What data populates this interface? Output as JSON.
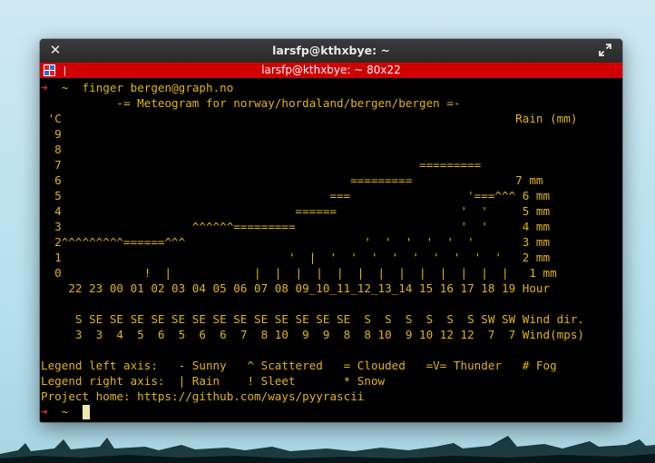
{
  "window": {
    "title": "larsfp@kthxbye: ~",
    "close_icon": "close-icon",
    "maximize_icon": "maximize-icon"
  },
  "tab": {
    "title": "larsfp@kthxbye: ~ 80x22",
    "separator": "|",
    "icon": "terminal-app-icon"
  },
  "colors": {
    "terminal_bg": "#000000",
    "terminal_fg": "#e0b318",
    "prompt_arrow": "#e23030",
    "tab_bar": "#d10000",
    "title_bar": "#2f2f2f",
    "cursor": "#f3e7a8"
  },
  "terminal": {
    "prompt_arrow": "➜",
    "prompt_dir": "~",
    "command": "finger bergen@graph.no",
    "lines": [
      "           -= Meteogram for norway/hordaland/bergen/bergen =-",
      " 'C                                                                  Rain (mm)",
      "  9",
      "  8",
      "  7                                                    =========",
      "  6                                          =========               7 mm",
      "  5                                       ===                 '===^^^ 6 mm",
      "  4                                  ======                  '  '     5 mm",
      "  3                   ^^^^^^=========                        '  '     4 mm",
      "  2^^^^^^^^^======^^^                          '  '  '  '  '  '       3 mm",
      "  1                                 '  |  '  '  '  '  '  '  '  '  '   2 mm",
      "  0            !  |            |  |  |  |  |  |  |  |  |  |  |  |  |   1 mm",
      "    22 23 00 01 02 03 04 05 06 07 08 09_10_11_12_13_14 15 16 17 18 19 Hour",
      "",
      "     S SE SE SE SE SE SE SE SE SE SE SE SE SE  S  S  S  S  S  S SW SW Wind dir.",
      "     3  3  4  5  6  5  6  6  7  8 10  9  9  8  8 10  9 10 12 12  7  7 Wind(mps)",
      "",
      "Legend left axis:   - Sunny   ^ Scattered   = Clouded   =V= Thunder   # Fog",
      "Legend right axis:  | Rain    ! Sleet       * Snow",
      "Project home: https://github.com/ways/pyyrascii"
    ],
    "final_prompt_arrow": "➜",
    "final_prompt_dir": "~"
  }
}
